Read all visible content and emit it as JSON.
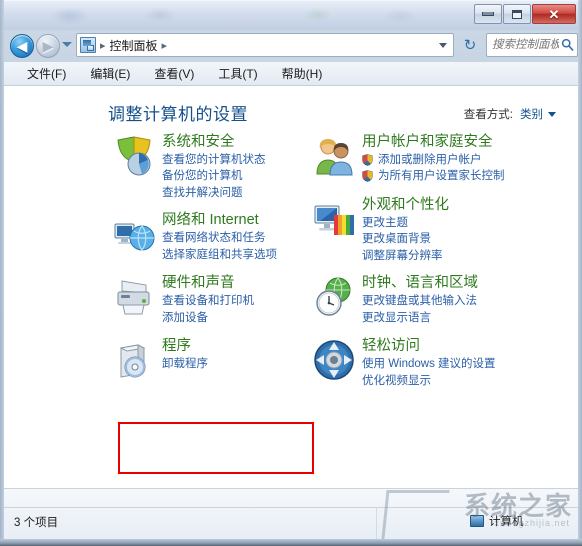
{
  "window": {
    "controls": {
      "minimize_label": "最小化",
      "maximize_label": "最大化",
      "close_label": "✕"
    }
  },
  "navbar": {
    "back_glyph": "◀",
    "forward_glyph": "▶",
    "breadcrumb_root": "控制面板",
    "separator": "▸",
    "refresh_glyph": "↻",
    "search_placeholder": "搜索控制面板",
    "search_value": "",
    "search_icon": "search-icon"
  },
  "menubar": {
    "items": [
      {
        "label": "文件(F)"
      },
      {
        "label": "编辑(E)"
      },
      {
        "label": "查看(V)"
      },
      {
        "label": "工具(T)"
      },
      {
        "label": "帮助(H)"
      }
    ]
  },
  "main": {
    "page_title": "调整计算机的设置",
    "view_by_label": "查看方式:",
    "view_by_value": "类别",
    "columns": {
      "left": [
        {
          "icon": "shield-system-icon",
          "title": "系统和安全",
          "links": [
            {
              "label": "查看您的计算机状态",
              "shield": false
            },
            {
              "label": "备份您的计算机",
              "shield": false
            },
            {
              "label": "查找并解决问题",
              "shield": false
            }
          ]
        },
        {
          "icon": "network-globe-icon",
          "title": "网络和 Internet",
          "links": [
            {
              "label": "查看网络状态和任务",
              "shield": false
            },
            {
              "label": "选择家庭组和共享选项",
              "shield": false
            }
          ]
        },
        {
          "icon": "printer-icon",
          "title": "硬件和声音",
          "links": [
            {
              "label": "查看设备和打印机",
              "shield": false
            },
            {
              "label": "添加设备",
              "shield": false
            }
          ]
        },
        {
          "icon": "programs-cd-icon",
          "title": "程序",
          "links": [
            {
              "label": "卸载程序",
              "shield": false
            }
          ]
        }
      ],
      "right": [
        {
          "icon": "users-icon",
          "title": "用户帐户和家庭安全",
          "links": [
            {
              "label": "添加或删除用户帐户",
              "shield": true
            },
            {
              "label": "为所有用户设置家长控制",
              "shield": true
            }
          ]
        },
        {
          "icon": "monitor-palette-icon",
          "title": "外观和个性化",
          "links": [
            {
              "label": "更改主题",
              "shield": false
            },
            {
              "label": "更改桌面背景",
              "shield": false
            },
            {
              "label": "调整屏幕分辨率",
              "shield": false
            }
          ]
        },
        {
          "icon": "clock-globe-icon",
          "title": "时钟、语言和区域",
          "links": [
            {
              "label": "更改键盘或其他输入法",
              "shield": false
            },
            {
              "label": "更改显示语言",
              "shield": false
            }
          ]
        },
        {
          "icon": "ease-of-access-icon",
          "title": "轻松访问",
          "links": [
            {
              "label": "使用 Windows 建议的设置",
              "shield": false
            },
            {
              "label": "优化视频显示",
              "shield": false
            }
          ]
        }
      ]
    },
    "highlight": {
      "color": "#e60000",
      "target": "程序"
    }
  },
  "statusbar": {
    "item_count": "3 个项目",
    "computer_label": "计算机"
  },
  "watermark": {
    "text": "系统之家",
    "subtext": "xitongzhijia.net"
  },
  "colors": {
    "title_blue": "#14508c",
    "category_green": "#2f7a1e",
    "link_blue": "#2b5fa8",
    "highlight_red": "#e60000"
  }
}
